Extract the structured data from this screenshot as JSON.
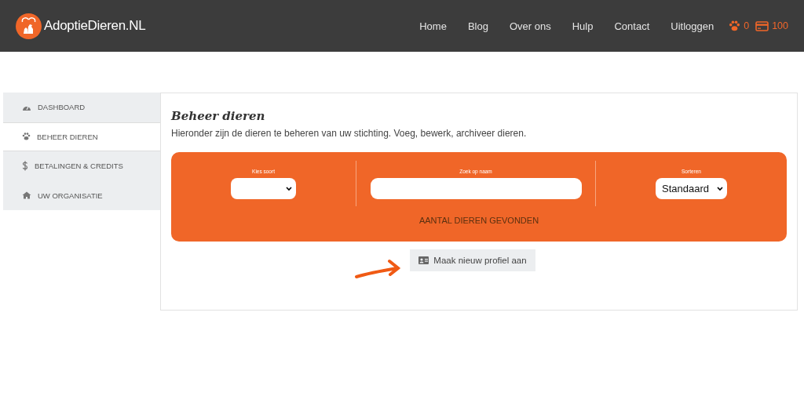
{
  "header": {
    "logo_text": "AdoptieDieren.NL",
    "nav": [
      "Home",
      "Blog",
      "Over ons",
      "Hulp",
      "Contact",
      "Uitloggen"
    ],
    "paw_count": "0",
    "credit_count": "100"
  },
  "sidebar": {
    "items": [
      {
        "label": "DASHBOARD",
        "selected": false
      },
      {
        "label": "BEHEER DIEREN",
        "selected": true
      },
      {
        "label": "BETALINGEN & CREDITS",
        "selected": false
      },
      {
        "label": "UW ORGANISATIE",
        "selected": false
      }
    ]
  },
  "main": {
    "title": "Beheer dieren",
    "description": "Hieronder zijn de dieren te beheren van uw stichting. Voeg, bewerk, archiveer dieren.",
    "filters": {
      "species_label": "Kies soort",
      "name_label": "Zoek op naam",
      "sort_label": "Sorteren",
      "sort_value": "Standaard",
      "result_text": "AANTAL DIEREN GEVONDEN"
    },
    "new_profile_button": "Maak nieuw profiel aan"
  }
}
